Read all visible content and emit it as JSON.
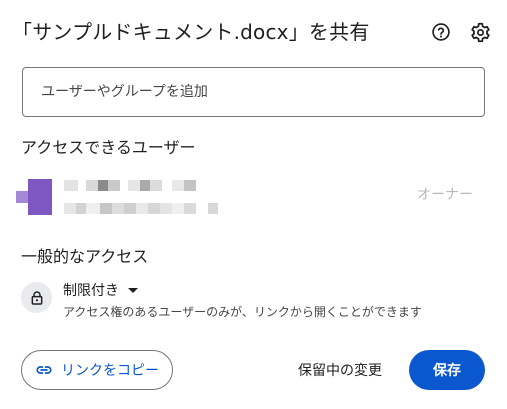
{
  "dialog": {
    "title": "「サンプルドキュメント.docx」を共有",
    "help_icon": "help-circle-icon",
    "settings_icon": "gear-icon"
  },
  "add_people": {
    "placeholder": "ユーザーやグループを追加"
  },
  "people_with_access": {
    "heading": "アクセスできるユーザー",
    "users": [
      {
        "name": "",
        "email": "",
        "role": "オーナー",
        "avatar_color": "#7e57c2"
      }
    ]
  },
  "general_access": {
    "heading": "一般的なアクセス",
    "icon": "lock-icon",
    "selected_option": "制限付き",
    "description": "アクセス権のあるユーザーのみが、リンクから開くことができます"
  },
  "footer": {
    "copy_link_label": "リンクをコピー",
    "copy_link_icon": "link-icon",
    "pending_label": "保留中の変更",
    "save_label": "保存"
  },
  "colors": {
    "accent": "#0b57d0",
    "text": "#1f1f1f",
    "muted": "#444746",
    "owner_label": "#b8b8b8"
  }
}
